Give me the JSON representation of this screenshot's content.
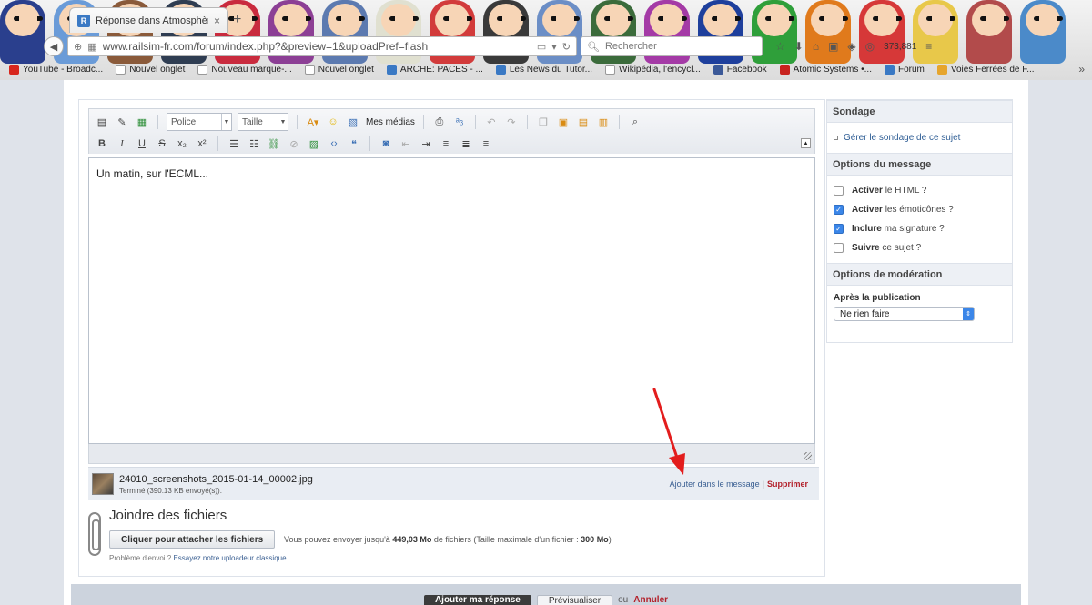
{
  "browser": {
    "tab_title": "Réponse dans Atmosphère...",
    "tab_close": "×",
    "new_tab": "+",
    "url": "www.railsim-fr.com/forum/index.php?&preview=1&uploadPref=flash",
    "search_placeholder": "Rechercher",
    "counter": "373,881"
  },
  "bookmarks": [
    {
      "label": "YouTube - Broadc...",
      "icon": "youtube-icon"
    },
    {
      "label": "Nouvel onglet",
      "icon": "page-icon"
    },
    {
      "label": "Nouveau marque-...",
      "icon": "page-icon"
    },
    {
      "label": "Nouvel onglet",
      "icon": "page-icon"
    },
    {
      "label": "ARCHE: PACES - ...",
      "icon": "arche-icon"
    },
    {
      "label": "Les News du Tutor...",
      "icon": "tutor-icon"
    },
    {
      "label": "Wikipédia, l'encycl...",
      "icon": "wikipedia-icon"
    },
    {
      "label": "Facebook",
      "icon": "facebook-icon"
    },
    {
      "label": "Atomic Systems •...",
      "icon": "atomic-icon"
    },
    {
      "label": "Forum",
      "icon": "forum-icon"
    },
    {
      "label": "Voies Ferrées de F...",
      "icon": "rail-icon"
    }
  ],
  "editor": {
    "font_select": "Police",
    "size_select": "Taille",
    "media_label": "Mes médias",
    "content": "Un matin, sur l'ECML..."
  },
  "attachment": {
    "filename": "24010_screenshots_2015-01-14_00002.jpg",
    "status": "Terminé (390.13 KB envoyé(s)).",
    "add_label": "Ajouter dans le message",
    "separator": "|",
    "delete_label": "Supprimer"
  },
  "join": {
    "title": "Joindre des fichiers",
    "button": "Cliquer pour attacher les fichiers",
    "info_prefix": "Vous pouvez envoyer jusqu'à",
    "info_size": "449,03 Mo",
    "info_middle": "de fichiers (Taille maximale d'un fichier :",
    "info_max": "300 Mo",
    "info_suffix": ")",
    "problem_text": "Problème d'envoi ?",
    "problem_link": "Essayez notre uploadeur classique"
  },
  "sidebar": {
    "poll_title": "Sondage",
    "poll_link": "Gérer le sondage de ce sujet",
    "options_title": "Options du message",
    "options": [
      {
        "strong": "Activer",
        "rest": "le HTML ?",
        "checked": false
      },
      {
        "strong": "Activer",
        "rest": "les émoticônes ?",
        "checked": true
      },
      {
        "strong": "Inclure",
        "rest": "ma signature ?",
        "checked": true
      },
      {
        "strong": "Suivre",
        "rest": "ce sujet ?",
        "checked": false
      }
    ],
    "moderation_title": "Options de modération",
    "after_label": "Après la publication",
    "after_value": "Ne rien faire"
  },
  "bottom": {
    "submit": "Ajouter ma réponse",
    "preview": "Prévisualiser",
    "or": "ou",
    "cancel": "Annuler"
  },
  "colors": {
    "link": "#2f5e95",
    "delete": "#b3202a",
    "checkbox_on": "#3b86e8",
    "annotation_arrow": "#e31d1d"
  }
}
